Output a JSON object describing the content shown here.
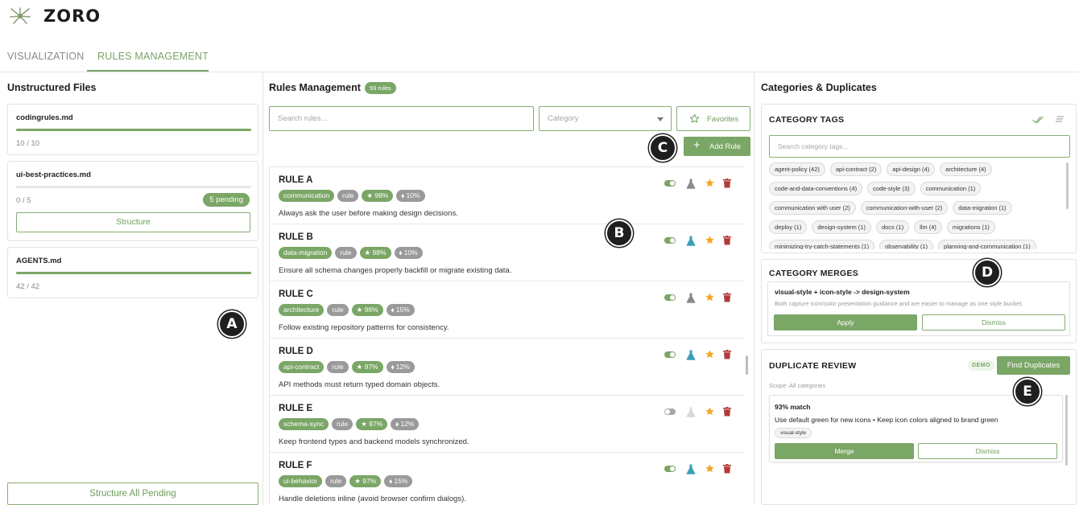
{
  "app": {
    "name": "ZORO"
  },
  "tabs": [
    {
      "label": "VISUALIZATION",
      "active": false
    },
    {
      "label": "RULES MANAGEMENT",
      "active": true
    }
  ],
  "colors": {
    "accent": "#7aa666",
    "muted_badge": "#9a9a9a",
    "star": "#f5a623",
    "trash": "#b33a3a",
    "flask_active": "#3aa0b8"
  },
  "unstructured": {
    "title": "Unstructured Files",
    "files": [
      {
        "name": "codingrules.md",
        "count": "10 / 10",
        "progress": 1.0
      },
      {
        "name": "ui-best-practices.md",
        "count": "0 / 5",
        "progress": 0.0,
        "pending": "5 pending",
        "button": "Structure"
      },
      {
        "name": "AGENTS.md",
        "count": "42 / 42",
        "progress": 1.0
      }
    ],
    "structure_all": "Structure All Pending"
  },
  "rules": {
    "title": "Rules Management",
    "count_badge": "93 rules",
    "search_placeholder": "Search rules...",
    "category_placeholder": "Category",
    "favorites_label": "Favorites",
    "add_label": "Add Rule",
    "items": [
      {
        "title": "RULE A",
        "category": "communication",
        "kind": "rule",
        "score": "★ 98%",
        "pct": "⬧ 10%",
        "desc": "Always ask the user before making design decisions.",
        "enabled": true,
        "tested": false
      },
      {
        "title": "RULE B",
        "category": "data-migration",
        "kind": "rule",
        "score": "★ 98%",
        "pct": "⬧ 10%",
        "desc": "Ensure all schema changes properly backfill or migrate existing data.",
        "enabled": true,
        "tested": true
      },
      {
        "title": "RULE C",
        "category": "architecture",
        "kind": "rule",
        "score": "★ 96%",
        "pct": "⬧ 15%",
        "desc": "Follow existing repository patterns for consistency.",
        "enabled": true,
        "tested": false
      },
      {
        "title": "RULE D",
        "category": "api-contract",
        "kind": "rule",
        "score": "★ 97%",
        "pct": "⬧ 12%",
        "desc": "API methods must return typed domain objects.",
        "enabled": true,
        "tested": true
      },
      {
        "title": "RULE E",
        "category": "schema-sync",
        "kind": "rule",
        "score": "★ 97%",
        "pct": "⬧ 12%",
        "desc": "Keep frontend types and backend models synchronized.",
        "enabled": false,
        "tested": false
      },
      {
        "title": "RULE F",
        "category": "ui-behavior",
        "kind": "rule",
        "score": "★ 97%",
        "pct": "⬧ 15%",
        "desc": "Handle deletions inline (avoid browser confirm dialogs).",
        "enabled": true,
        "tested": true
      }
    ]
  },
  "categories": {
    "title": "Categories & Duplicates",
    "tags": {
      "title": "CATEGORY TAGS",
      "search_placeholder": "Search category tags...",
      "rows": [
        [
          "agent-policy (42)",
          "api-contract (2)",
          "api-design (4)",
          "architecture (4)"
        ],
        [
          "code-and-data-conventions (4)",
          "code-style (3)",
          "communication (1)"
        ],
        [
          "communication with user (2)",
          "communication-with-user (2)",
          "data-migration (1)"
        ],
        [
          "deploy (1)",
          "design-system (1)",
          "docs (1)",
          "llm (4)",
          "migrations (1)"
        ],
        [
          "minimizing-try-catch-statements (1)",
          "observability (1)",
          "planning-and-communication (1)"
        ]
      ]
    },
    "merges": {
      "title": "CATEGORY MERGES",
      "item_title": "visual-style + icon-style -> design-system",
      "item_desc": "Both capture icon/color presentation guidance and are easier to manage as one style bucket.",
      "apply": "Apply",
      "dismiss": "Dismiss"
    },
    "duplicates": {
      "title": "DUPLICATE REVIEW",
      "demo": "DEMO",
      "find": "Find Duplicates",
      "scope": "Scope: All categories",
      "match": "93% match",
      "text": "Use default green for new icons • Keep icon colors aligned to brand green",
      "chip": "visual-style",
      "merge": "Merge",
      "dismiss": "Dismiss"
    }
  },
  "markers": {
    "a": "A",
    "b": "B",
    "c": "C",
    "d": "D",
    "e": "E"
  }
}
